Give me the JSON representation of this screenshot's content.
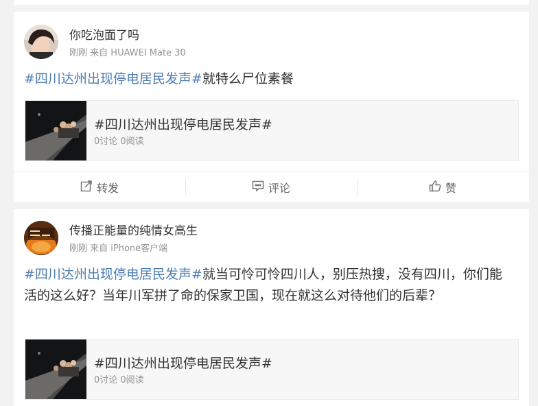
{
  "posts": [
    {
      "username": "你吃泡面了吗",
      "time": "刚刚",
      "source": "来自 HUAWEI Mate 30",
      "hashtag": "#四川达州出现停电居民发声#",
      "text": "就特么尸位素餐",
      "topic": {
        "title": "#四川达州出现停电居民发声#",
        "stats": "0讨论 0阅读"
      },
      "actions": {
        "repost": "转发",
        "comment": "评论",
        "like": "赞"
      }
    },
    {
      "username": "传播正能量的纯情女高生",
      "time": "刚刚",
      "source": "来自 iPhone客户端",
      "hashtag": "#四川达州出现停电居民发声#",
      "text": "就当可怜可怜四川人，别压热搜，没有四川，你们能活的这么好？当年川军拼了命的保家卫国，现在就这么对待他们的后辈？",
      "topic": {
        "title": "#四川达州出现停电居民发声#",
        "stats": "0讨论 0阅读"
      }
    }
  ],
  "colors": {
    "hashtag": "#4c7cb3",
    "meta": "#939393",
    "text": "#333333"
  },
  "icons": {
    "repost": "repost-icon",
    "comment": "comment-icon",
    "like": "thumbs-up-icon"
  }
}
